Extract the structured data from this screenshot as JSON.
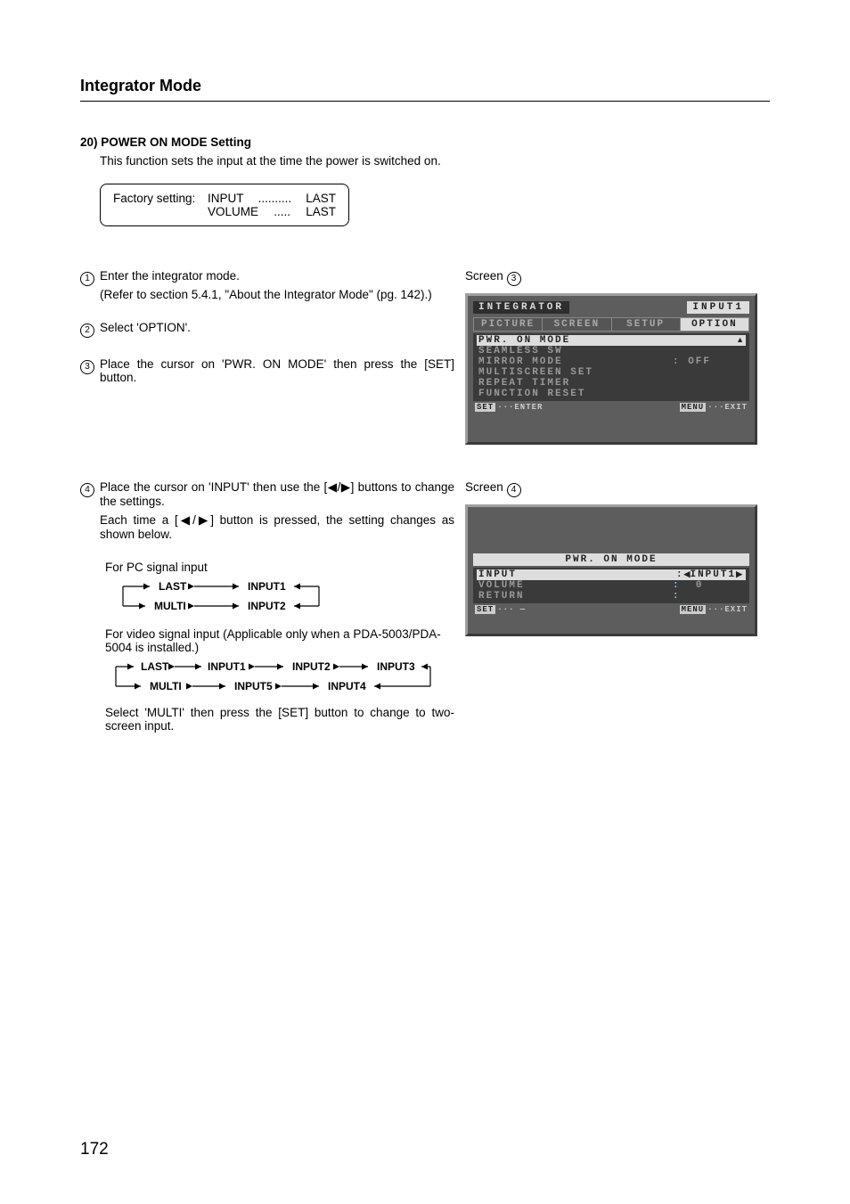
{
  "section_title": "Integrator Mode",
  "heading": "20) POWER ON MODE Setting",
  "intro": "This function sets the input at the time the power is switched on.",
  "factory": {
    "label": "Factory setting:",
    "rows": [
      {
        "key": "INPUT",
        "dots": "..........",
        "val": "LAST"
      },
      {
        "key": "VOLUME",
        "dots": ".....",
        "val": "LAST"
      }
    ]
  },
  "steps": {
    "s1": {
      "num": "1",
      "body": "Enter the integrator mode.",
      "sub": "(Refer to section 5.4.1, \"About the Integrator Mode\" (pg. 142).)"
    },
    "s2": {
      "num": "2",
      "body": "Select 'OPTION'."
    },
    "s3": {
      "num": "3",
      "body": "Place the cursor on 'PWR. ON MODE' then press the [SET] button."
    },
    "s4": {
      "num": "4",
      "body": "Place the cursor on 'INPUT' then use the [◀/▶] buttons to change the settings.",
      "sub": "Each time a [◀/▶] button is pressed, the setting changes as shown below."
    }
  },
  "pc_label": "For PC signal input",
  "video_label": "For video signal input (Applicable only when a PDA-5003/PDA-5004 is installed.)",
  "multi_note": "Select 'MULTI' then press the [SET] button to change to two-screen input.",
  "cycle_pc": [
    "LAST",
    "INPUT1",
    "MULTI",
    "INPUT2"
  ],
  "cycle_video": [
    "LAST",
    "INPUT1",
    "INPUT2",
    "INPUT3",
    "MULTI",
    "INPUT5",
    "INPUT4"
  ],
  "screen3": {
    "label": "Screen",
    "num": "3",
    "title_left": "INTEGRATOR",
    "title_right": "INPUT1",
    "tabs": [
      "PICTURE",
      "SCREEN",
      "SETUP",
      "OPTION"
    ],
    "selected_tab": 3,
    "items": [
      {
        "label": "PWR. ON  MODE",
        "sel": true,
        "arrow": true
      },
      {
        "label": "SEAMLESS  SW"
      },
      {
        "label": "MIRROR  MODE",
        "val": ":  OFF"
      },
      {
        "label": "MULTISCREEN  SET"
      },
      {
        "label": "REPEAT  TIMER"
      },
      {
        "label": "FUNCTION  RESET"
      }
    ],
    "footer_left_key": "SET",
    "footer_left": "···ENTER",
    "footer_right_key": "MENU",
    "footer_right": "···EXIT"
  },
  "screen4": {
    "label": "Screen",
    "num": "4",
    "title": "PWR. ON  MODE",
    "items": [
      {
        "label": "INPUT",
        "sel": true,
        "val_pre": ":",
        "val": "INPUT1"
      },
      {
        "label": "VOLUME",
        "val_pre": ":",
        "val": "0"
      },
      {
        "label": " RETURN",
        "val_pre": ":"
      }
    ],
    "footer_left_key": "SET",
    "footer_left": "··· —",
    "footer_right_key": "MENU",
    "footer_right": "···EXIT"
  },
  "page_number": "172"
}
